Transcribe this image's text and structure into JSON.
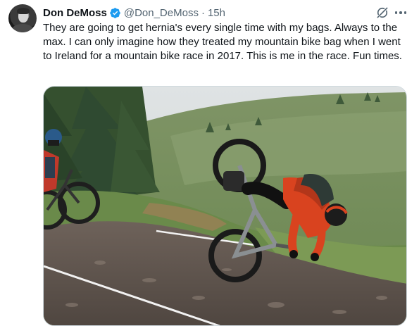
{
  "tweet": {
    "author": {
      "display_name": "Don DeMoss",
      "handle": "@Don_DeMoss",
      "verified": true,
      "avatar_icon": "profile-avatar"
    },
    "separator": "·",
    "timestamp": "15h",
    "text": "They are going to get hernia's every single time with my bags. Always to the max. I can only imagine how they treated my mountain bike bag when I went to Ireland for a mountain bike race in 2017. This is me in the race. Fun times.",
    "actions": {
      "grok_icon": "grok-icon",
      "more_icon": "more-options-icon"
    }
  },
  "colors": {
    "text_primary": "#0f1419",
    "text_secondary": "#536471",
    "verified_blue": "#1d9bf0",
    "border": "#cfd9de"
  }
}
